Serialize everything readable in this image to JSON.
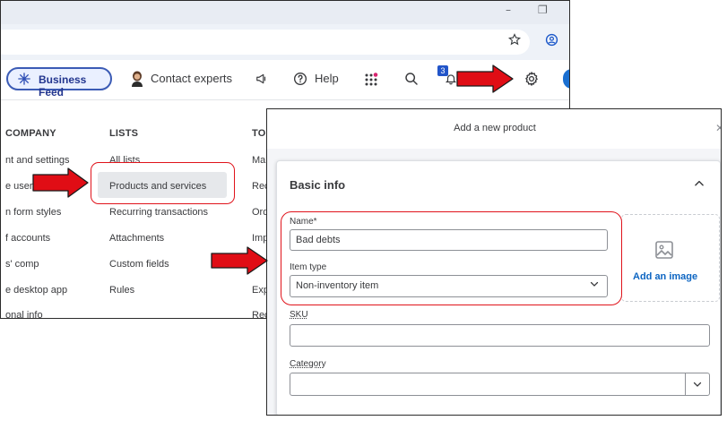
{
  "menu_screenshot": {
    "window_controls": {
      "minimize": "–",
      "restore": "❐"
    },
    "browser_icons": [
      "star-icon",
      "profile-icon"
    ],
    "navbar": {
      "business_feed": "Business Feed",
      "contact_experts": "Contact experts",
      "help": "Help",
      "notification_badge": "3"
    },
    "columns": {
      "company": {
        "header": "COMPANY",
        "items": [
          "nt and settings",
          "e users",
          "n form styles",
          "f accounts",
          "s' comp",
          "e desktop app",
          "onal info"
        ]
      },
      "lists": {
        "header": "LISTS",
        "items": [
          "All lists",
          "Products and services",
          "Recurring transactions",
          "Attachments",
          "Custom fields",
          "Rules"
        ]
      },
      "tools": {
        "header": "TO",
        "items": [
          "Ma",
          "Rec",
          "Ord",
          "Imp",
          "",
          "Exp",
          "Rec"
        ]
      }
    }
  },
  "dialog": {
    "title": "Add a new product",
    "section_title": "Basic info",
    "name_label": "Name*",
    "name_value": "Bad debts",
    "item_type_label": "Item type",
    "item_type_value": "Non-inventory item",
    "add_image": "Add an image",
    "sku_label": "SKU",
    "sku_value": "",
    "category_label": "Category",
    "category_value": ""
  },
  "colors": {
    "annotation_red": "#e0131b",
    "accent_blue": "#0d65c2",
    "business_feed_border": "#3b5bb5",
    "badge_blue": "#2255c9"
  }
}
